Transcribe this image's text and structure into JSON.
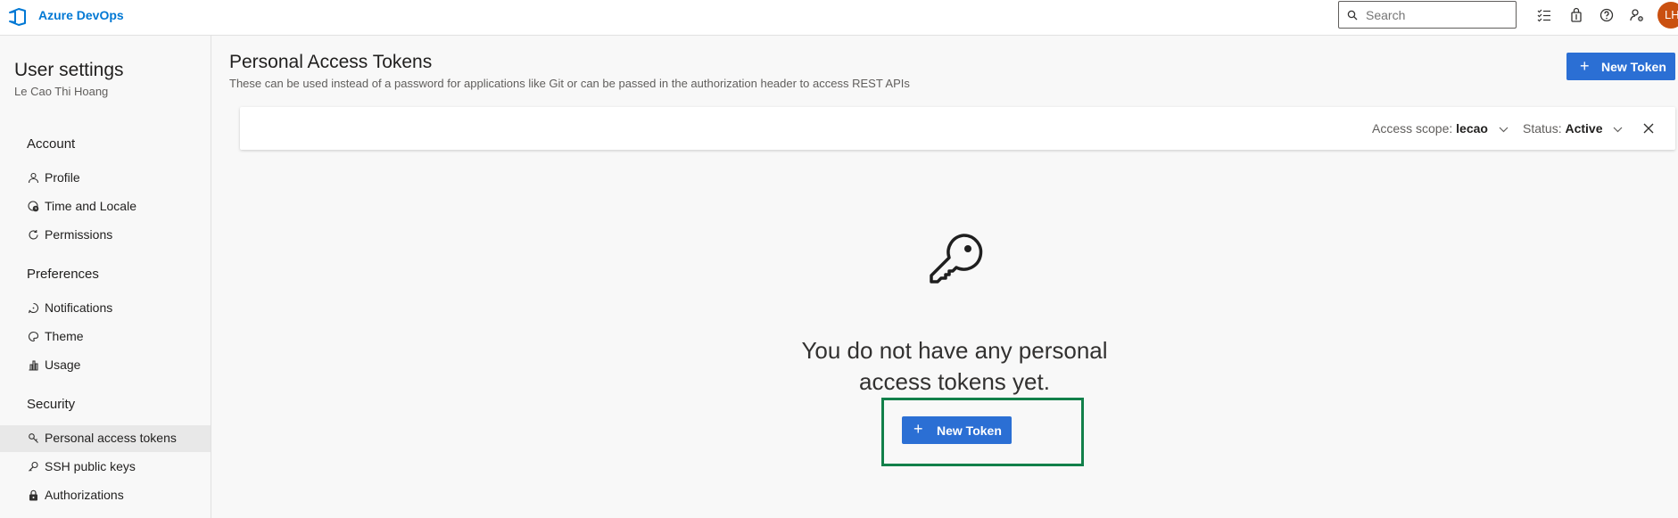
{
  "topbar": {
    "brand": "Azure DevOps",
    "search_placeholder": "Search",
    "icons": [
      "logo-icon",
      "search-icon",
      "task-list-icon",
      "marketplace-bag-icon",
      "help-icon",
      "user-settings-icon"
    ],
    "avatar_initials": "LH"
  },
  "sidebar": {
    "title": "User settings",
    "user": "Le Cao Thi Hoang",
    "sections": [
      {
        "heading": "Account",
        "items": [
          {
            "label": "Profile",
            "icon": "profile-icon"
          },
          {
            "label": "Time and Locale",
            "icon": "globe-clock-icon"
          },
          {
            "label": "Permissions",
            "icon": "refresh-icon"
          }
        ]
      },
      {
        "heading": "Preferences",
        "items": [
          {
            "label": "Notifications",
            "icon": "chat-icon"
          },
          {
            "label": "Theme",
            "icon": "palette-icon"
          },
          {
            "label": "Usage",
            "icon": "chart-icon"
          }
        ]
      },
      {
        "heading": "Security",
        "items": [
          {
            "label": "Personal access tokens",
            "icon": "token-icon",
            "selected": true
          },
          {
            "label": "SSH public keys",
            "icon": "key-small-icon"
          },
          {
            "label": "Authorizations",
            "icon": "lock-icon"
          }
        ]
      }
    ]
  },
  "main": {
    "title": "Personal Access Tokens",
    "description": "These can be used instead of a password for applications like Git or can be passed in the authorization header to access REST APIs",
    "new_token_label": "New Token",
    "filters": {
      "access_scope_label": "Access scope:",
      "access_scope_value": "lecao",
      "status_label": "Status:",
      "status_value": "Active"
    },
    "empty_message": "You do not have any personal access tokens yet.",
    "empty_button_label": "New Token",
    "accent_color": "#2b6fd4",
    "highlight_color": "#12804a"
  }
}
